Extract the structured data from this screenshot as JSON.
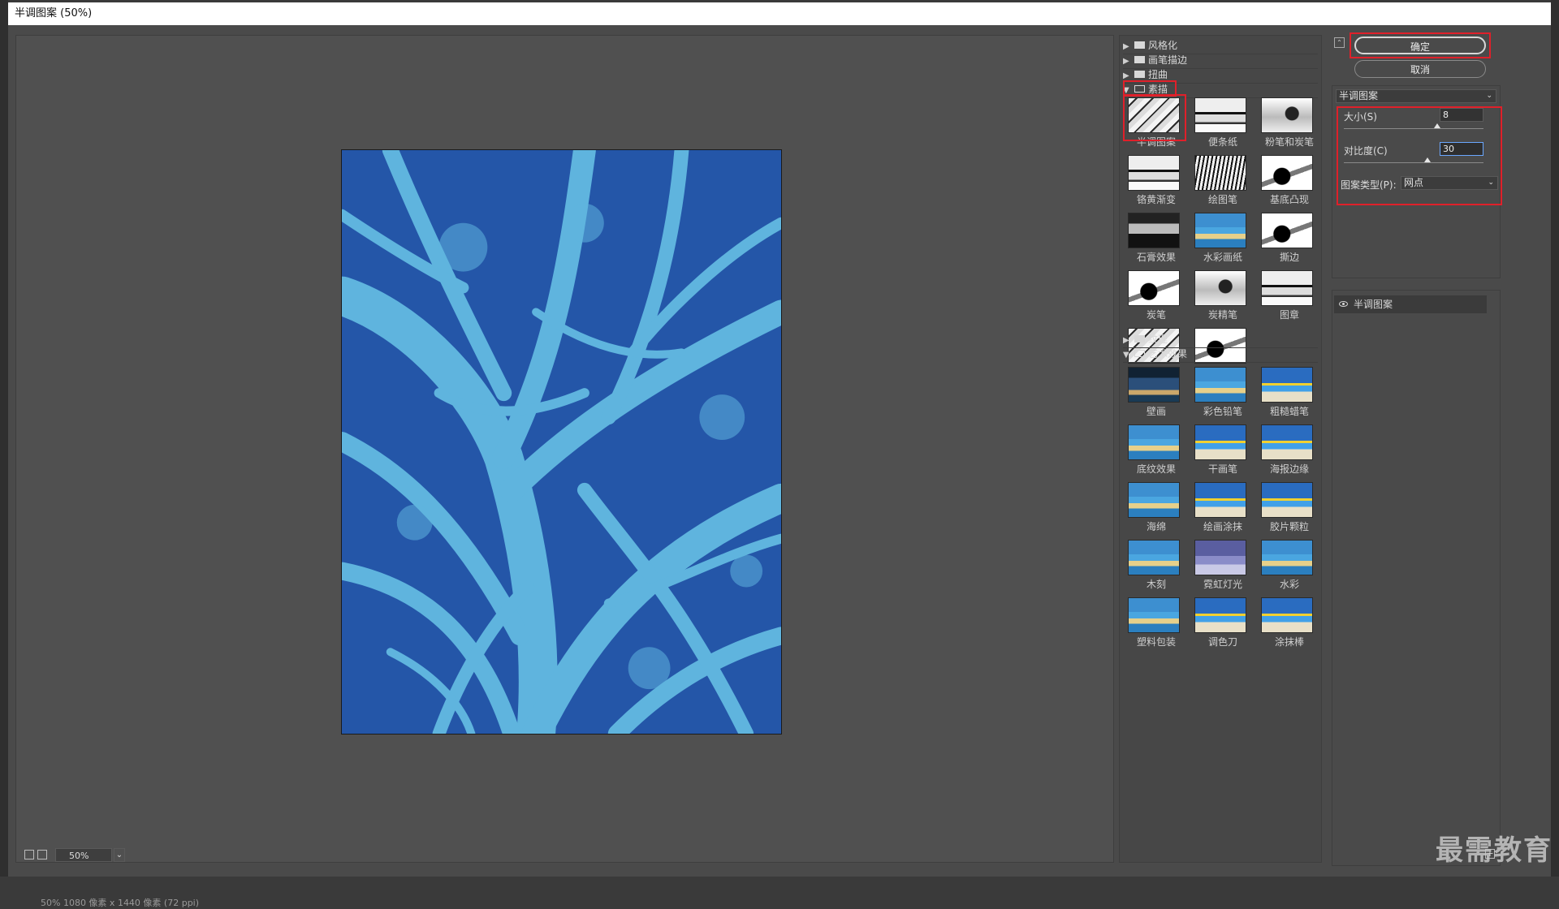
{
  "window": {
    "title": "半调图案 (50%)"
  },
  "preview": {
    "zoom": "50%",
    "status": "50%  1080 像素 x 1440 像素 (72 ppi)"
  },
  "gallery": {
    "folders": {
      "stylize": "风格化",
      "brush_strokes": "画笔描边",
      "distort": "扭曲",
      "sketch": "素描",
      "texture": "纹理",
      "artistic": "艺术效果"
    },
    "sketch_filters": [
      "半调图案",
      "便条纸",
      "粉笔和炭笔",
      "铬黄渐变",
      "绘图笔",
      "基底凸现",
      "石膏效果",
      "水彩画纸",
      "撕边",
      "炭笔",
      "炭精笔",
      "图章",
      "网状",
      "影印"
    ],
    "artistic_filters": [
      "壁画",
      "彩色铅笔",
      "粗糙蜡笔",
      "底纹效果",
      "干画笔",
      "海报边缘",
      "海绵",
      "绘画涂抹",
      "胶片颗粒",
      "木刻",
      "霓虹灯光",
      "水彩",
      "塑料包装",
      "调色刀",
      "涂抹棒"
    ]
  },
  "controls": {
    "ok": "确定",
    "cancel": "取消",
    "filter_select": "半调图案",
    "size_label": "大小(S)",
    "size_value": "8",
    "size_fraction": 0.67,
    "contrast_label": "对比度(C)",
    "contrast_value": "30",
    "contrast_fraction": 0.6,
    "pattern_type_label": "图案类型(P):",
    "pattern_type_value": "网点"
  },
  "layers": {
    "items": [
      "半调图案"
    ]
  },
  "watermark": "最需教育",
  "colors": {
    "accent_red": "#e0202a",
    "canvas_dark": "#2456a8",
    "canvas_light": "#5fb4de"
  }
}
